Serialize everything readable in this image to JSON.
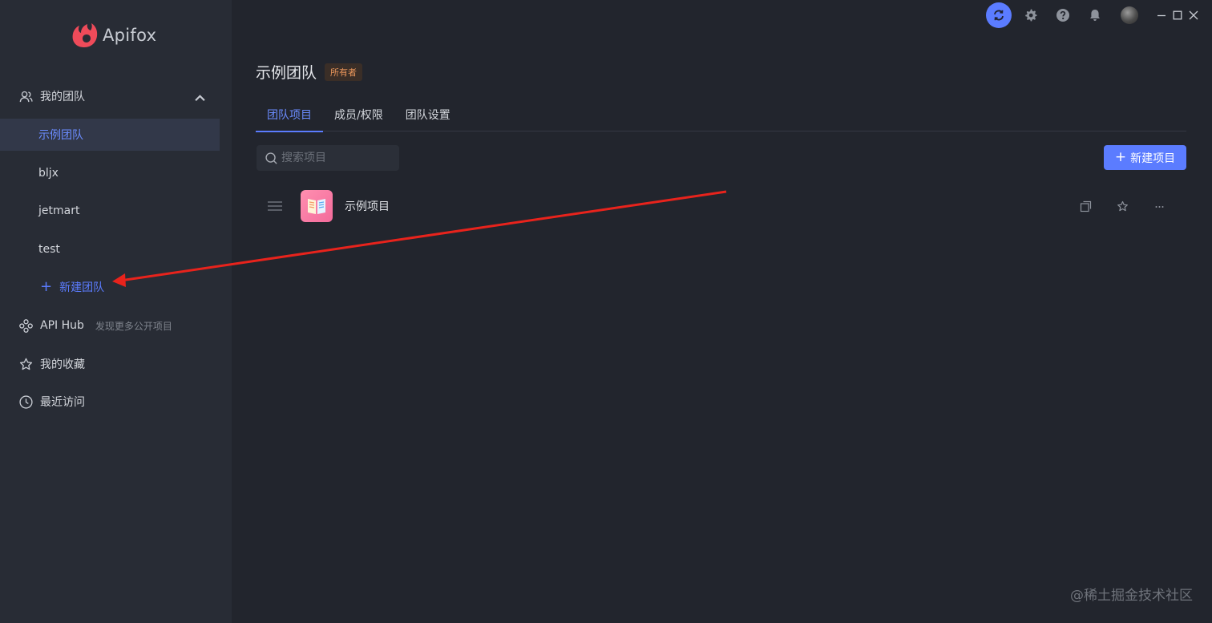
{
  "app": {
    "logo_text": "Apifox"
  },
  "sidebar": {
    "my_teams": {
      "label": "我的团队",
      "icon": "users-icon"
    },
    "teams": [
      {
        "label": "示例团队",
        "active": true
      },
      {
        "label": "bljx",
        "active": false
      },
      {
        "label": "jetmart",
        "active": false
      },
      {
        "label": "test",
        "active": false
      }
    ],
    "new_team": {
      "label": "新建团队"
    },
    "api_hub": {
      "label": "API Hub",
      "sub": "发现更多公开项目",
      "icon": "api-hub-icon"
    },
    "favorites": {
      "label": "我的收藏",
      "icon": "star-icon"
    },
    "recent": {
      "label": "最近访问",
      "icon": "clock-icon"
    }
  },
  "topbar": {
    "icons": [
      "sync-icon",
      "gear-icon",
      "help-icon",
      "bell-icon",
      "avatar"
    ],
    "window_controls": [
      "minimize-icon",
      "maximize-icon",
      "close-icon"
    ]
  },
  "team": {
    "name": "示例团队",
    "badge": "所有者"
  },
  "tabs": [
    {
      "label": "团队项目",
      "active": true
    },
    {
      "label": "成员/权限",
      "active": false
    },
    {
      "label": "团队设置",
      "active": false
    }
  ],
  "search": {
    "placeholder": "搜索项目",
    "value": ""
  },
  "new_project": {
    "label": "新建项目"
  },
  "projects": [
    {
      "name": "示例项目",
      "icon": "book-icon"
    }
  ],
  "watermark": "@稀土掘金技术社区",
  "colors": {
    "accent": "#5b7cff",
    "sidebar_bg": "#282c35",
    "main_bg": "#22252d",
    "badge_text": "#e8955b",
    "annotation_arrow": "#e8231c"
  }
}
